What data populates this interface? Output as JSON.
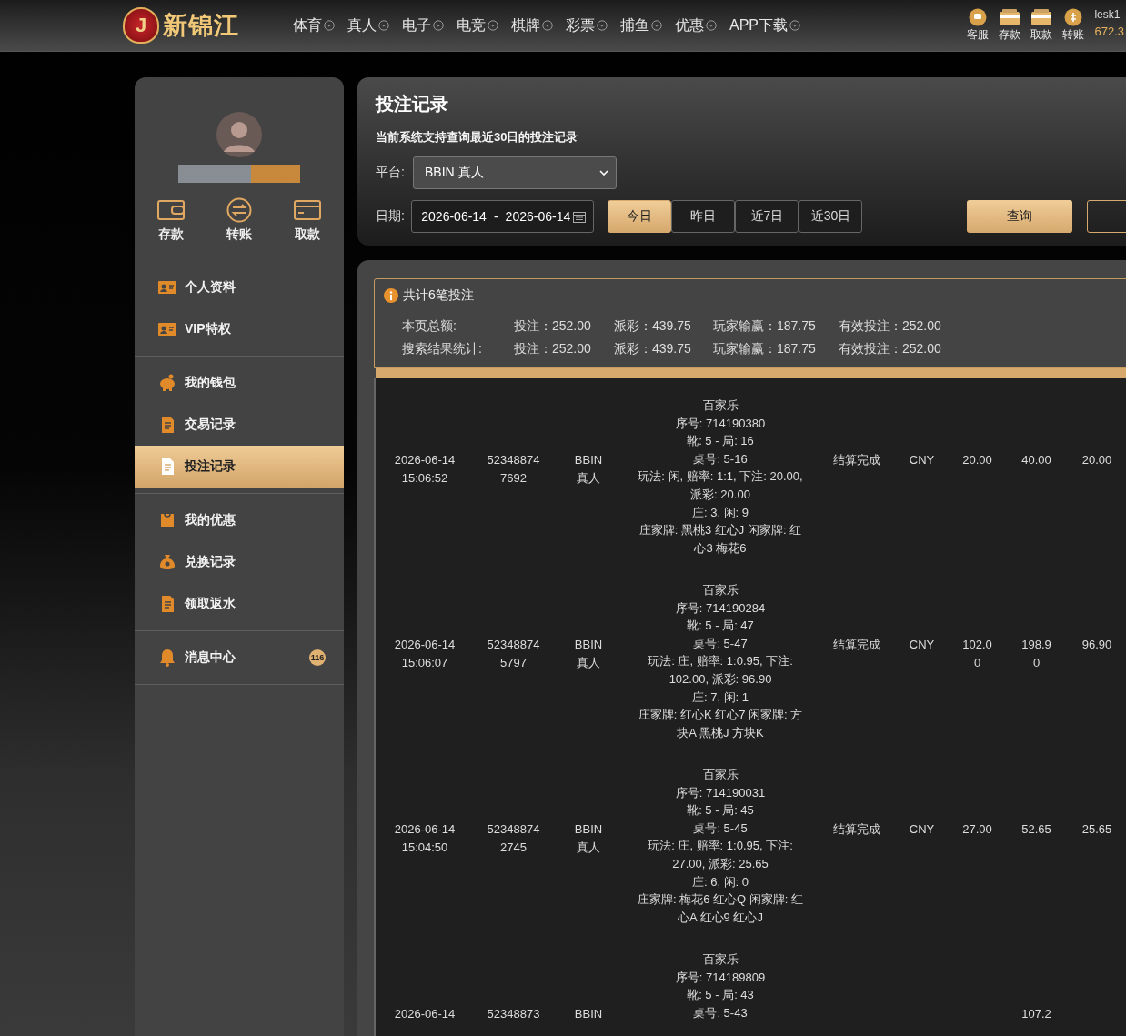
{
  "header": {
    "logo_text": "新锦江",
    "logo_badge": "J",
    "nav": [
      {
        "label": "体育"
      },
      {
        "label": "真人"
      },
      {
        "label": "电子"
      },
      {
        "label": "电竞"
      },
      {
        "label": "棋牌"
      },
      {
        "label": "彩票"
      },
      {
        "label": "捕鱼"
      },
      {
        "label": "优惠"
      },
      {
        "label": "APP下载"
      }
    ],
    "actions": [
      {
        "label": "客服"
      },
      {
        "label": "存款"
      },
      {
        "label": "取款"
      },
      {
        "label": "转账"
      }
    ],
    "username": "lesk1",
    "balance": "672.3"
  },
  "sidebar": {
    "quick_actions": [
      {
        "label": "存款"
      },
      {
        "label": "转账"
      },
      {
        "label": "取款"
      }
    ],
    "menu_groups": [
      [
        {
          "label": "个人资料",
          "selected": false
        },
        {
          "label": "VIP特权",
          "selected": false
        }
      ],
      [
        {
          "label": "我的钱包",
          "selected": false
        },
        {
          "label": "交易记录",
          "selected": false
        },
        {
          "label": "投注记录",
          "selected": true
        }
      ],
      [
        {
          "label": "我的优惠",
          "selected": false
        },
        {
          "label": "兑换记录",
          "selected": false
        },
        {
          "label": "领取返水",
          "selected": false
        }
      ],
      [
        {
          "label": "消息中心",
          "selected": false,
          "badge": "116"
        }
      ]
    ]
  },
  "filter": {
    "title": "投注记录",
    "note": "当前系统支持查询最近30日的投注记录",
    "platform_label": "平台:",
    "platform_value": "BBIN 真人",
    "date_label": "日期:",
    "date_start": "2026-06-14",
    "date_separator": "-",
    "date_end": "2026-06-14",
    "quick_ranges": [
      {
        "label": "今日",
        "selected": true
      },
      {
        "label": "昨日",
        "selected": false
      },
      {
        "label": "近7日",
        "selected": false
      },
      {
        "label": "近30日",
        "selected": false
      }
    ],
    "query_button": "查询"
  },
  "summary": {
    "count_text": "共计6笔投注",
    "rows": [
      {
        "label": "本页总额:",
        "items": [
          "投注：252.00",
          "派彩：439.75",
          "玩家输赢：187.75",
          "有效投注：252.00"
        ]
      },
      {
        "label": "搜索结果统计:",
        "items": [
          "投注：252.00",
          "派彩：439.75",
          "玩家输赢：187.75",
          "有效投注：252.00"
        ]
      }
    ]
  },
  "table": {
    "rows": [
      {
        "time": "2026-06-14 15:06:52",
        "order": "523488747692",
        "platform": "BBIN 真人",
        "details": [
          "百家乐",
          "序号: 714190380",
          "靴: 5 - 局: 16",
          "桌号: 5-16",
          "玩法: 闲, 赔率: 1:1, 下注: 20.00, 派彩: 20.00",
          "庄: 3, 闲: 9",
          "庄家牌: 黑桃3 红心J 闲家牌: 红心3 梅花6"
        ],
        "status": "结算完成",
        "currency": "CNY",
        "bet": "20.00",
        "payout": "40.00",
        "win": "20.00"
      },
      {
        "time": "2026-06-14 15:06:07",
        "order": "523488745797",
        "platform": "BBIN 真人",
        "details": [
          "百家乐",
          "序号: 714190284",
          "靴: 5 - 局: 47",
          "桌号: 5-47",
          "玩法: 庄, 赔率: 1:0.95, 下注: 102.00, 派彩: 96.90",
          "庄: 7, 闲: 1",
          "庄家牌: 红心K 红心7 闲家牌: 方块A 黑桃J 方块K"
        ],
        "status": "结算完成",
        "currency": "CNY",
        "bet": "102.00",
        "payout": "198.90",
        "win": "96.90"
      },
      {
        "time": "2026-06-14 15:04:50",
        "order": "523488742745",
        "platform": "BBIN 真人",
        "details": [
          "百家乐",
          "序号: 714190031",
          "靴: 5 - 局: 45",
          "桌号: 5-45",
          "玩法: 庄, 赔率: 1:0.95, 下注: 27.00, 派彩: 25.65",
          "庄: 6, 闲: 0",
          "庄家牌: 梅花6 红心Q 闲家牌: 红心A 红心9 红心J"
        ],
        "status": "结算完成",
        "currency": "CNY",
        "bet": "27.00",
        "payout": "52.65",
        "win": "25.65"
      },
      {
        "time": "2026-06-14",
        "order": "52348873",
        "platform": "BBIN",
        "details": [
          "百家乐",
          "序号: 714189809",
          "靴: 5 - 局: 43",
          "桌号: 5-43"
        ],
        "payout": "107.2"
      }
    ]
  }
}
